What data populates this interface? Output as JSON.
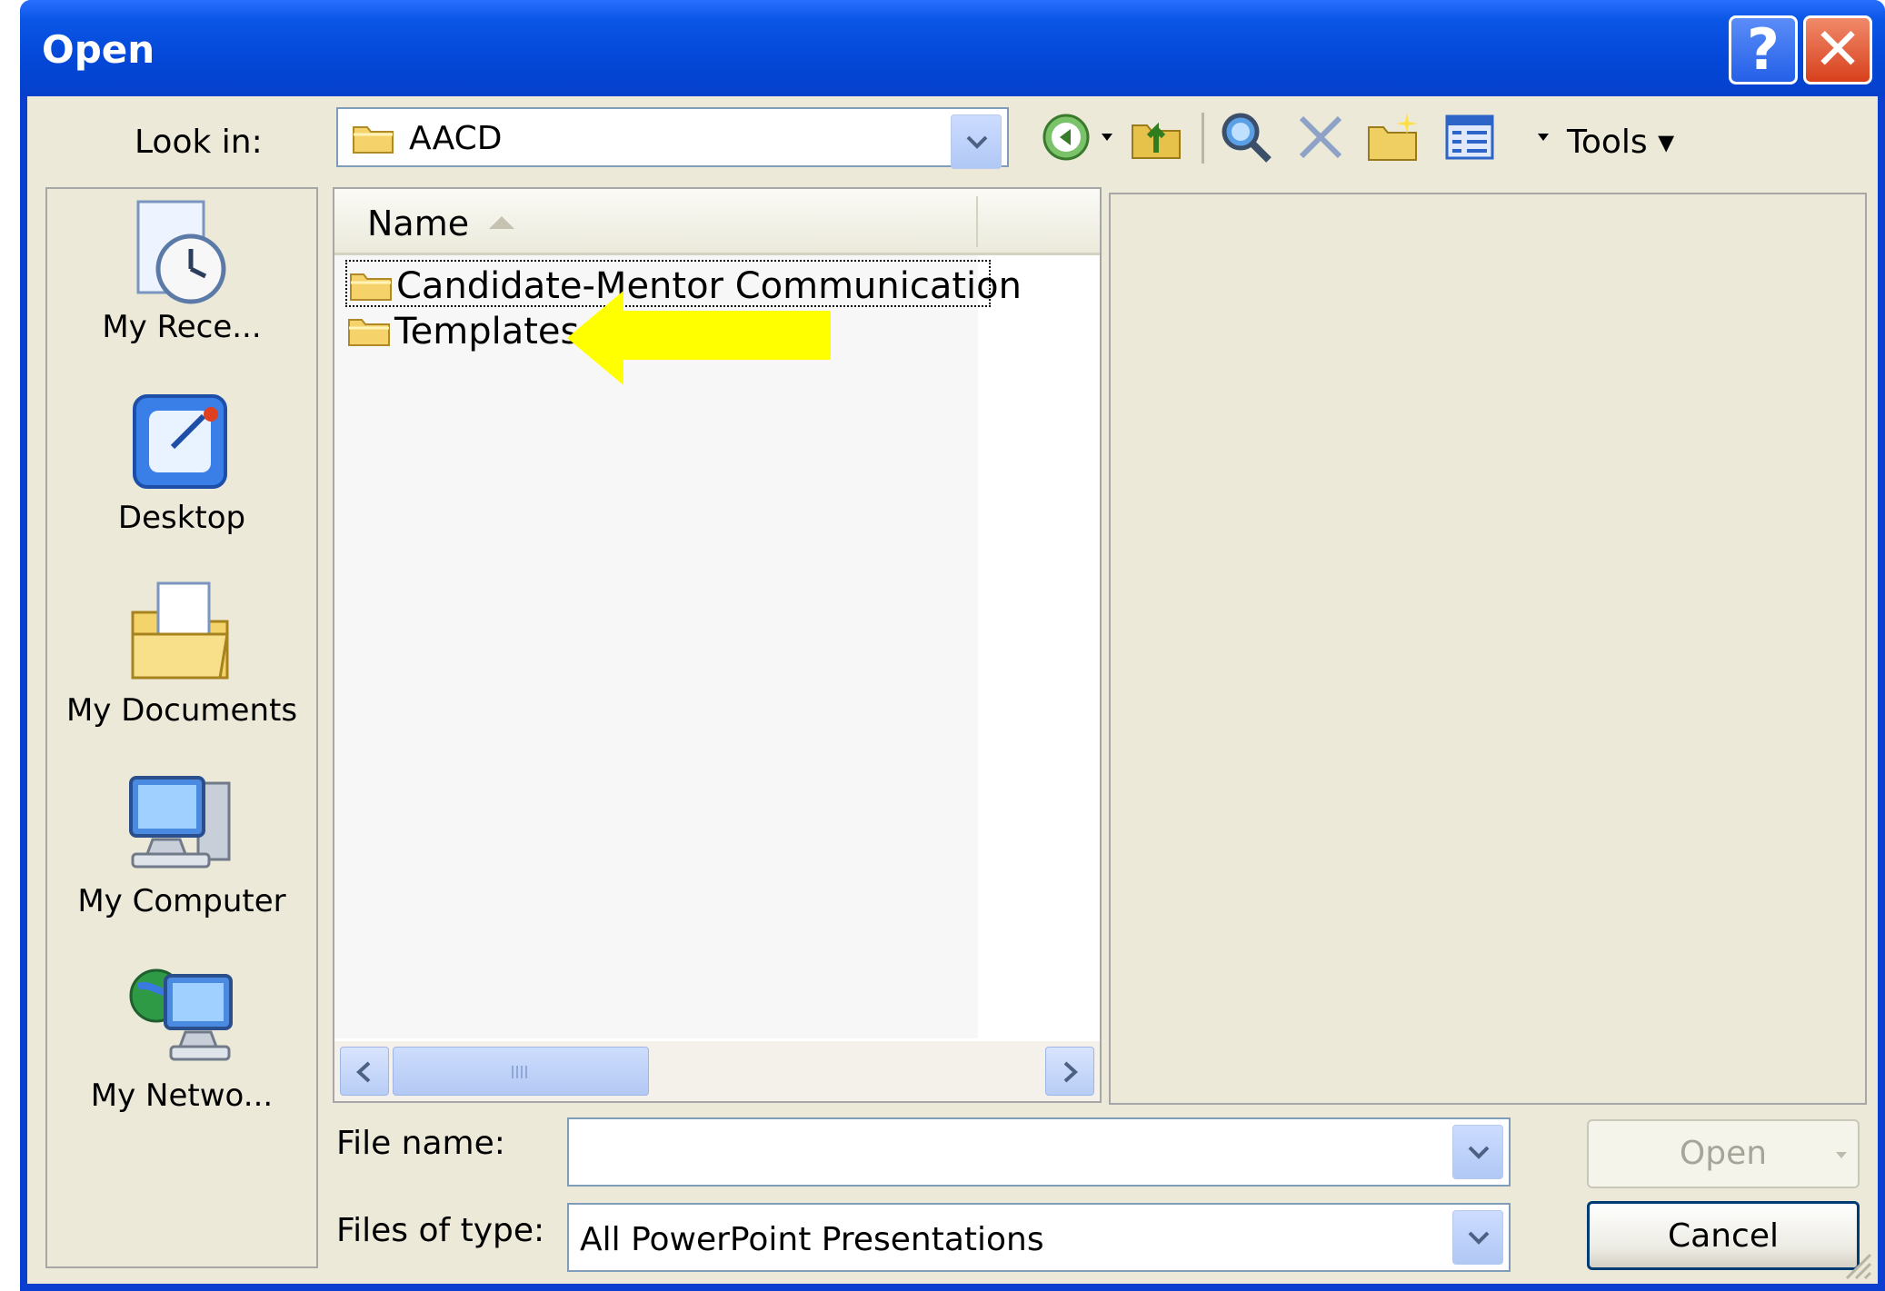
{
  "window": {
    "title": "Open"
  },
  "titlebar": {
    "help_label": "?",
    "close_label": "✕"
  },
  "lookin": {
    "label": "Look in:",
    "value": "AACD"
  },
  "toolbar": {
    "tools_label": "Tools ▾"
  },
  "places": [
    {
      "label": "My Rece...",
      "icon": "recent-documents-icon"
    },
    {
      "label": "Desktop",
      "icon": "desktop-icon"
    },
    {
      "label": "My Documents",
      "icon": "my-documents-icon"
    },
    {
      "label": "My Computer",
      "icon": "my-computer-icon"
    },
    {
      "label": "My Netwo...",
      "icon": "network-places-icon"
    }
  ],
  "filelist": {
    "column_name": "Name",
    "items": [
      {
        "name": "Candidate-Mentor Communication",
        "type": "folder"
      },
      {
        "name": "Templates",
        "type": "folder"
      }
    ]
  },
  "form": {
    "filename_label": "File name:",
    "filename_value": "",
    "filetype_label": "Files of type:",
    "filetype_value": "All PowerPoint Presentations",
    "open_label": "Open",
    "cancel_label": "Cancel"
  },
  "annotation": {
    "color": "#ffff00"
  }
}
